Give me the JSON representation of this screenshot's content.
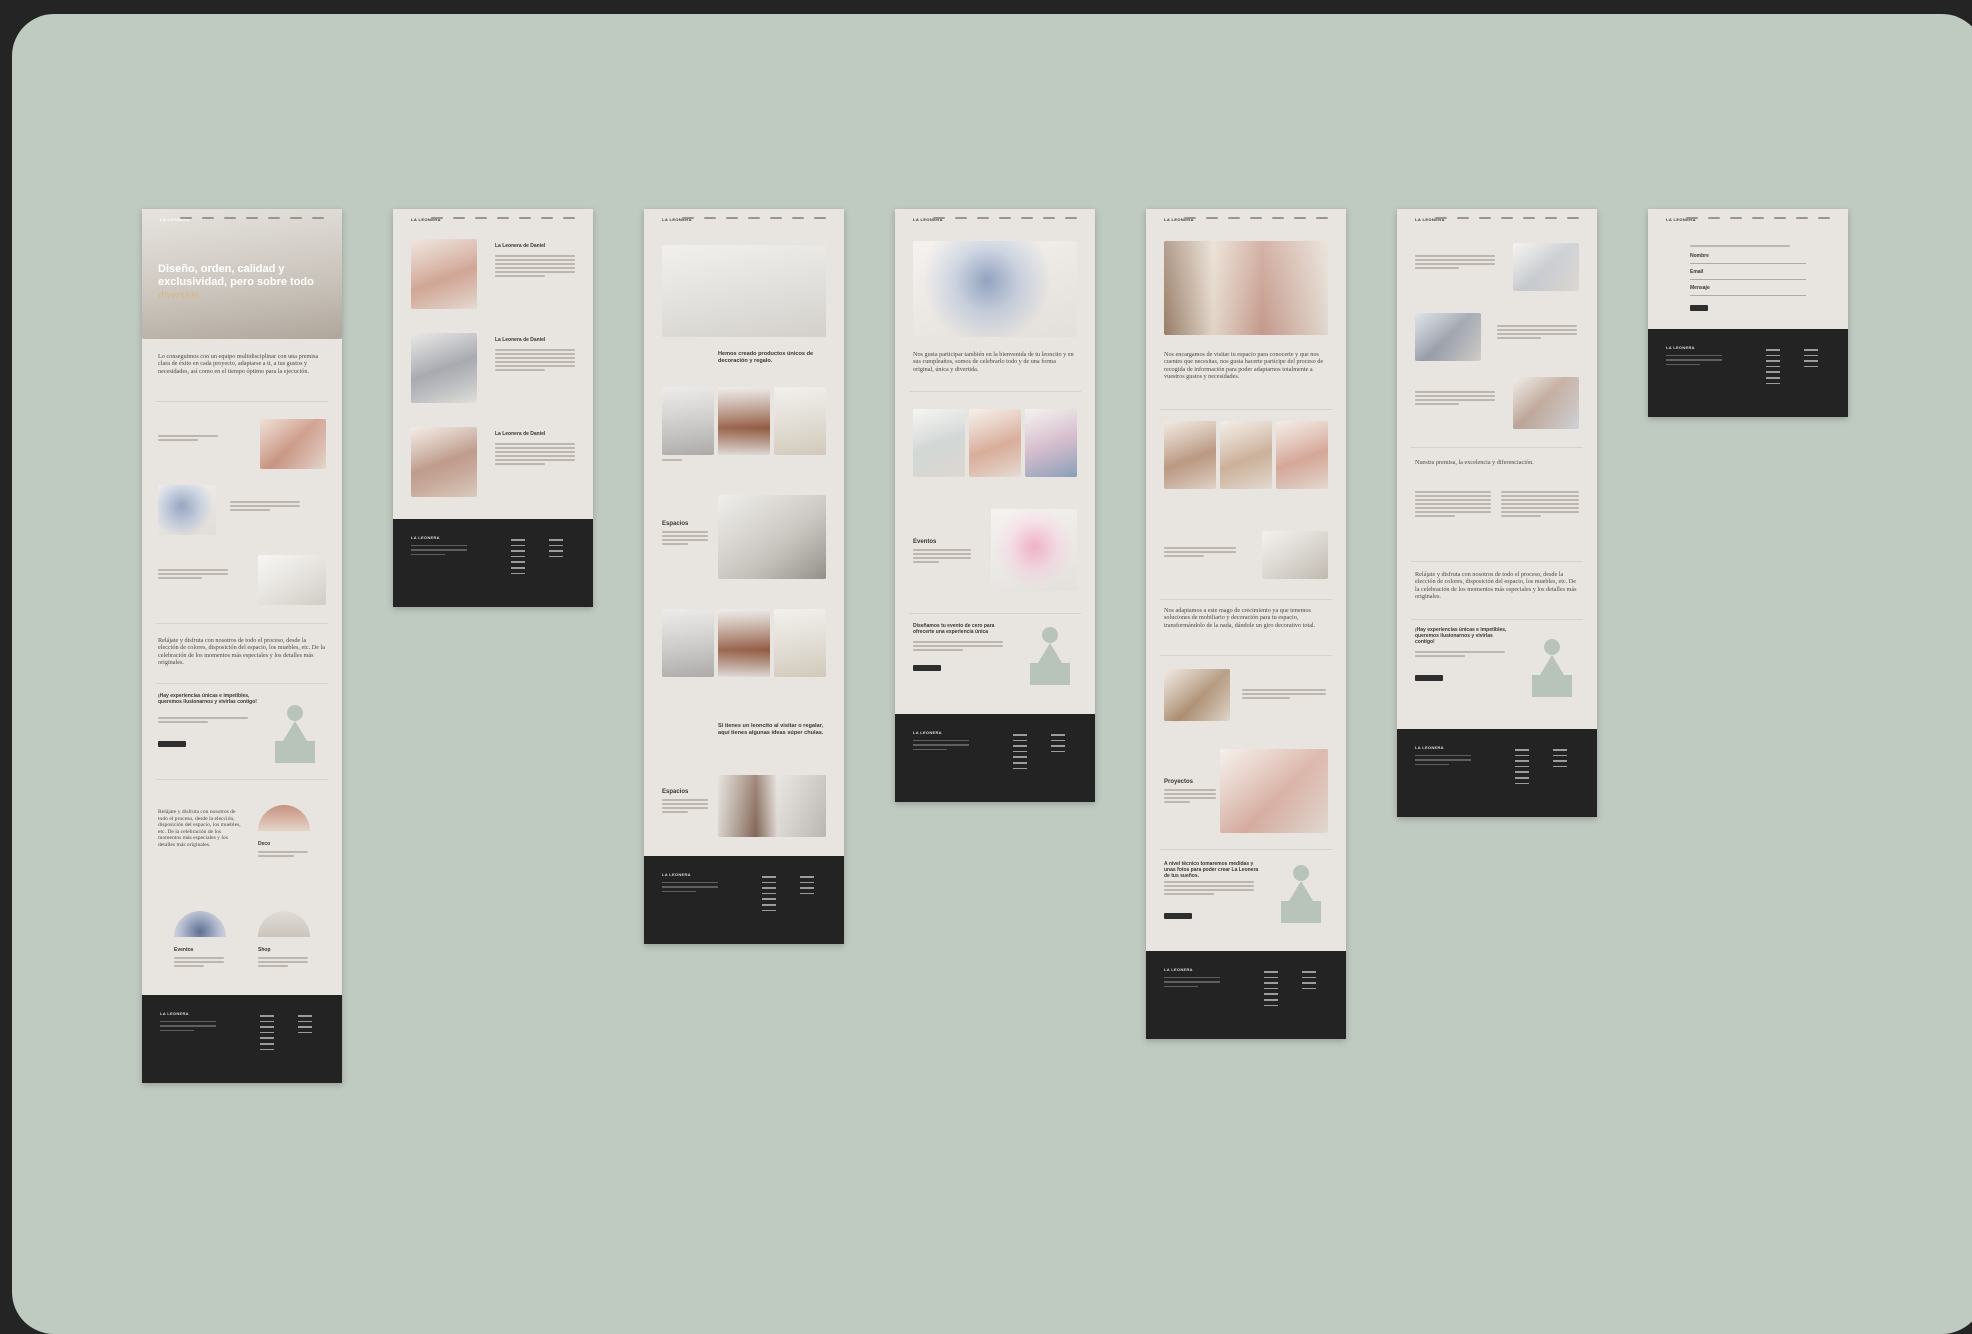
{
  "brand": "LA LEONERA",
  "home": {
    "hero_title": "Diseño, orden, calidad y exclusividad, pero sobre todo",
    "hero_accent": "diversión.",
    "intro": "Lo conseguimos con un equipo multidisciplinar con una premisa clara de éxito en cada proyecto, adaptarse a ti, a tus gustos y necesidades, así como en el tiempo óptimo para la ejecución.",
    "relax": "Relájate y disfruta con nosotros de todo el proceso, desde la elección de colores, disposición del espacio, los muebles, etc. De la celebración de los momentos más especiales y los detalles más originales.",
    "cta_title": "¡Hay experiencias únicas e impetibles, queremos ilusionarnos y vivirlas contigo!",
    "relax_short": "Relájate y disfruta con nosotros de todo el proceso, desde la elección, disposición del espacio, los muebles, etc. De la celebración de los momentos más especiales y los detalles más originales.",
    "cards": [
      "Deco",
      "Eventos",
      "Shop"
    ]
  },
  "blog": {
    "post_title": "La Leonera de Daniel",
    "posts": [
      "La Leonera de Daniel",
      "La Leonera de Daniel",
      "La Leonera de Daniel"
    ]
  },
  "shop": {
    "headline": "Hemos creado productos únicos de decoración y regalo.",
    "section": "Espacios",
    "headline2": "Si tienes un leoncito al visitar o regalar, aquí tienes algunas ideas súper chulas.",
    "section2": "Espacios"
  },
  "events": {
    "intro": "Nos gusta participar también en la bienvenida de tu leoncito y en sus cumpleaños, somos de celebrarlo todo y de una forma original, única y divertida.",
    "section": "Eventos",
    "cta_title": "Diseñamos tu evento de cero para ofrecerte una experiencia única"
  },
  "spaces": {
    "intro": "Nos encargamos de visitar tu espacio para conocerte y que nos cuentes que necesitas, nos gusta hacerte partícipe del proceso de recogida de información para poder adaptarnos totalmente a vuestros gustos y necesidades.",
    "adapt": "Nos adaptamos a este mago de crecimiento ya que tenemos soluciones de mobiliario y decoración para tu espacio, transformándolo de la nada, dándole un giro decorativo total.",
    "section": "Proyectos",
    "cta_title": "A nivel técnico tomaremos medidas y unas fotos para poder crear La Leonera de tus sueños."
  },
  "about": {
    "premise": "Nuestra premisa, la excelencia y diferenciación.",
    "relax": "Relájate y disfruta con nosotros de todo el proceso, desde la elección de colores, disposición del espacio, los muebles, etc. De la celebración de los momentos más especiales y los detalles más originales.",
    "cta_title": "¡Hay experiencias únicas e impetibles, queremos ilusionarnos y vivirlas contigo!"
  },
  "contact": {
    "fields": [
      "Nombre",
      "Email",
      "Mensaje"
    ]
  },
  "colors": {
    "canvas": "#bfcac1",
    "board": "#e8e4df",
    "footer": "#232323",
    "accent": "#d8b77b",
    "figure": "#b8c4ba"
  }
}
